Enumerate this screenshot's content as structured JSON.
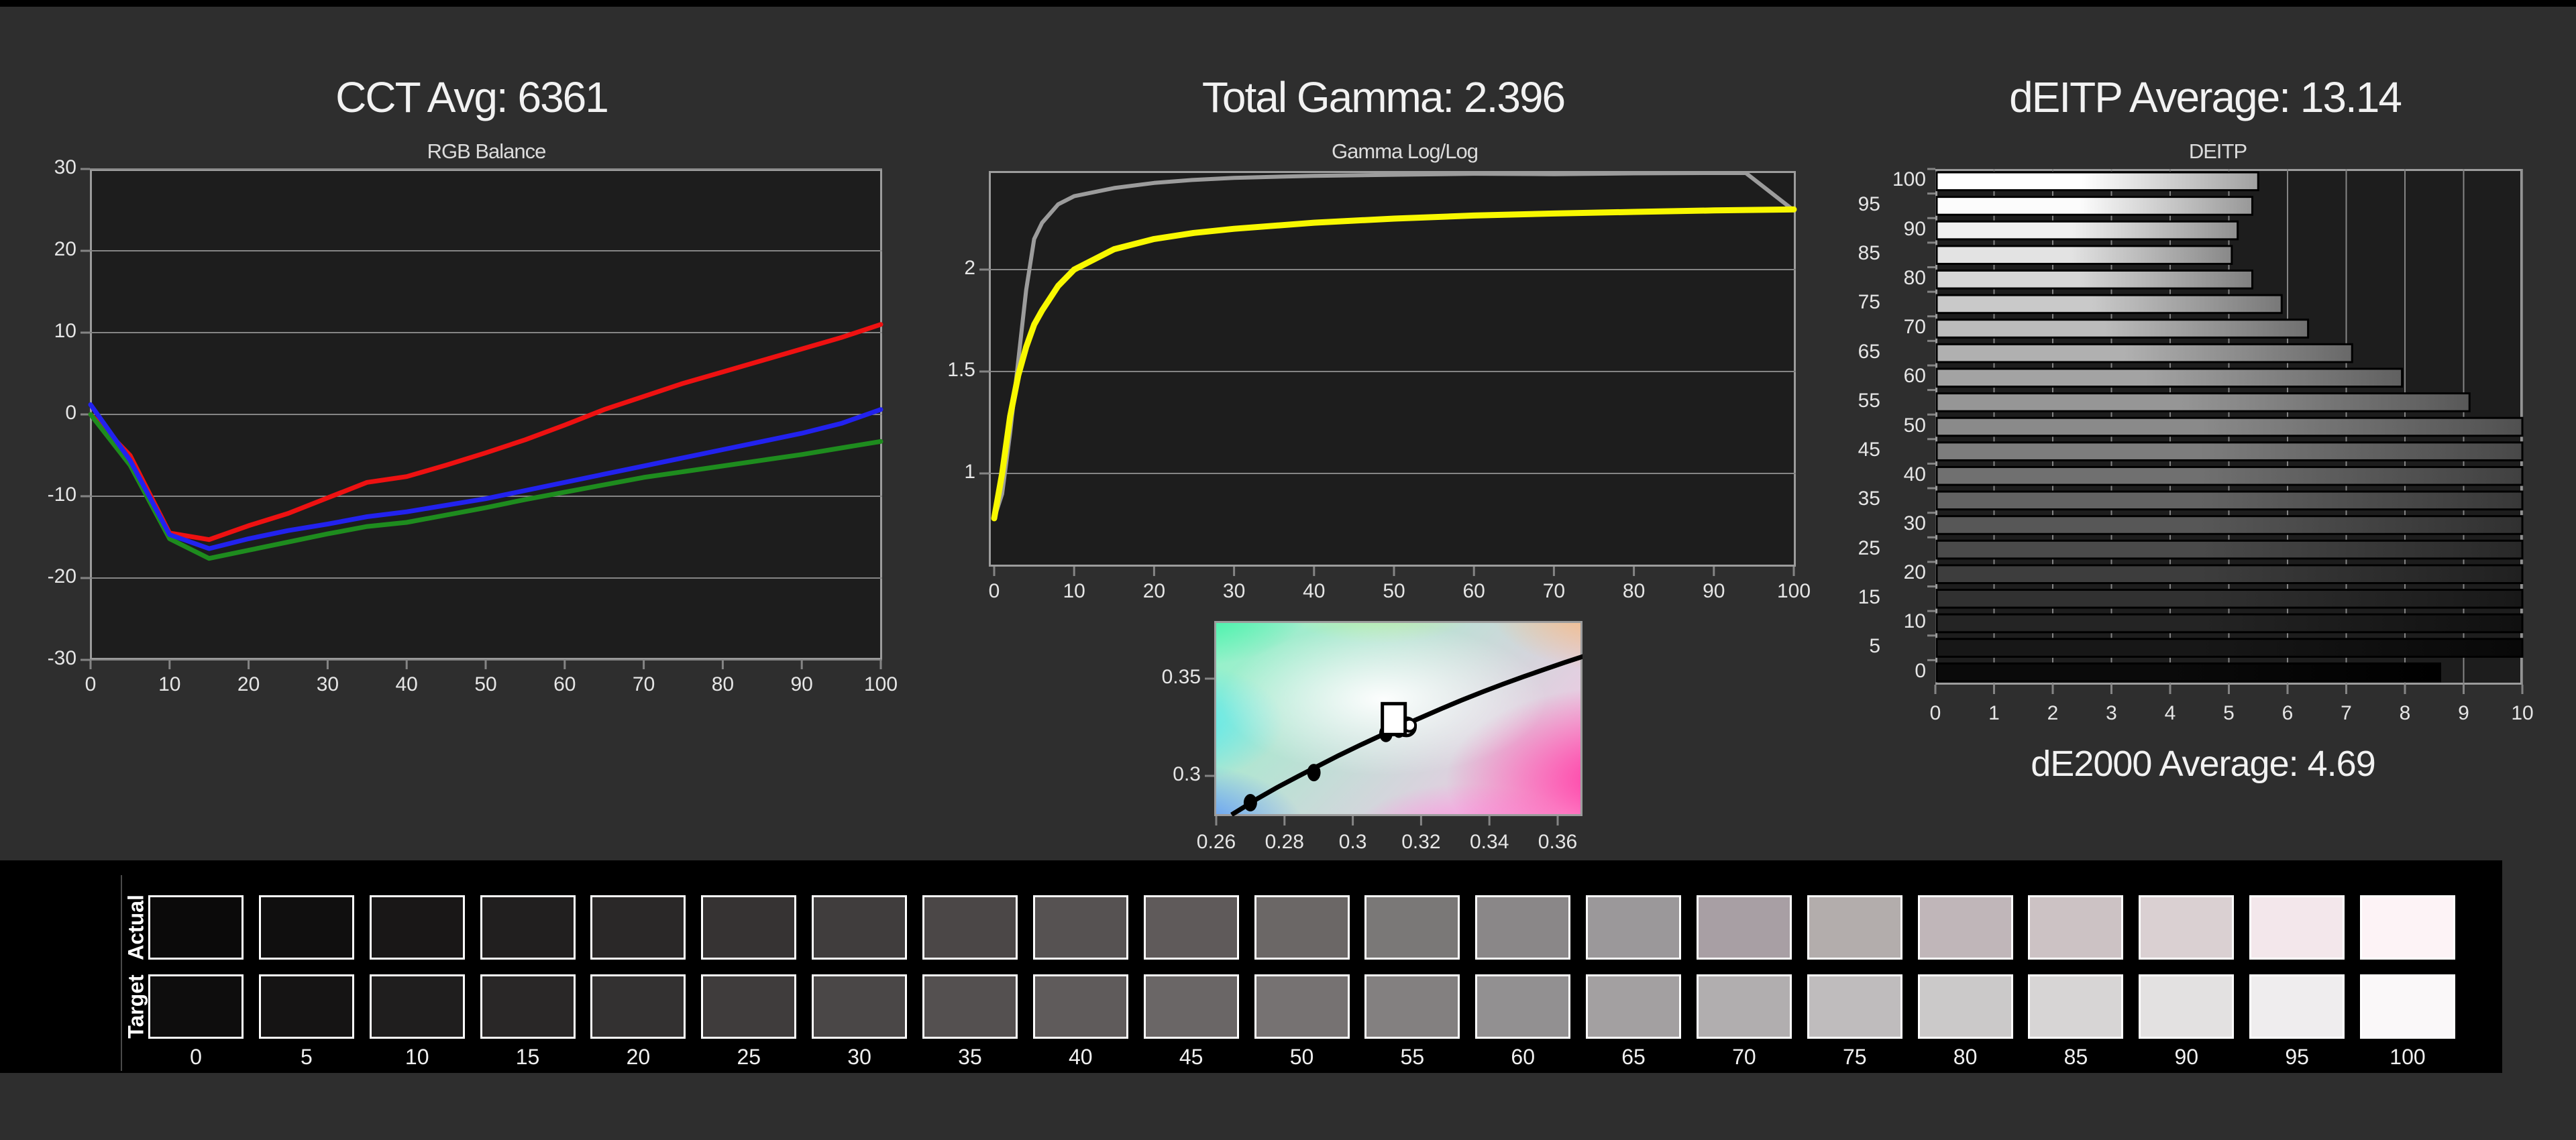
{
  "panels": {
    "cct": {
      "title": "CCT Avg: 6361",
      "chart_title": "RGB Balance"
    },
    "gamma": {
      "title": "Total Gamma: 2.396",
      "chart_title": "Gamma Log/Log"
    },
    "deitp": {
      "title": "dEITP Average: 13.14",
      "chart_title": "DEITP",
      "footer": "dE2000 Average: 4.69"
    }
  },
  "strip": {
    "row_labels": {
      "actual": "Actual",
      "target": "Target"
    }
  },
  "colors": {
    "red_line": "#ee1111",
    "green_line": "#1e8c1e",
    "blue_line": "#2222ee",
    "yellow_line": "#f8f800",
    "gray_line": "#9c9c9c",
    "grid": "#858585",
    "plot_border": "#9c9c9c",
    "plot_bg": "#1d1d1d",
    "page_bg": "#2e2e2e"
  },
  "chart_data": [
    {
      "id": "rgb_balance",
      "type": "line",
      "title": "RGB Balance",
      "xlabel": "",
      "ylabel": "",
      "ylim": [
        -30,
        30
      ],
      "xlim": [
        0,
        100
      ],
      "yticks": [
        30,
        20,
        10,
        0,
        -10,
        -20,
        -30
      ],
      "xticks": [
        0,
        10,
        20,
        30,
        40,
        50,
        60,
        70,
        80,
        90,
        100
      ],
      "x": [
        0,
        5,
        10,
        15,
        20,
        25,
        30,
        35,
        40,
        45,
        50,
        55,
        60,
        65,
        70,
        75,
        80,
        85,
        90,
        95,
        100
      ],
      "series": [
        {
          "name": "red",
          "values": [
            0,
            -5,
            -14.5,
            -15.3,
            -13.6,
            -12.1,
            -10.2,
            -8.3,
            -7.6,
            -6.2,
            -4.7,
            -3.1,
            -1.3,
            0.6,
            2.2,
            3.8,
            5.2,
            6.6,
            8.0,
            9.4,
            11.0
          ]
        },
        {
          "name": "green",
          "values": [
            0,
            -6.2,
            -15.2,
            -17.6,
            -16.6,
            -15.6,
            -14.6,
            -13.7,
            -13.2,
            -12.3,
            -11.4,
            -10.4,
            -9.5,
            -8.6,
            -7.7,
            -7.0,
            -6.3,
            -5.6,
            -4.9,
            -4.1,
            -3.3
          ]
        },
        {
          "name": "blue",
          "values": [
            1.2,
            -5.6,
            -14.7,
            -16.4,
            -15.2,
            -14.2,
            -13.4,
            -12.5,
            -11.9,
            -11.1,
            -10.3,
            -9.3,
            -8.3,
            -7.3,
            -6.3,
            -5.3,
            -4.3,
            -3.3,
            -2.3,
            -1.1,
            0.6
          ]
        }
      ]
    },
    {
      "id": "gamma_loglog",
      "type": "line",
      "title": "Gamma Log/Log",
      "ylim": [
        0.54,
        2.48
      ],
      "xlim": [
        0,
        100
      ],
      "yticks": [
        2,
        1.5,
        1
      ],
      "xticks": [
        0,
        10,
        20,
        30,
        40,
        50,
        60,
        70,
        80,
        90,
        100
      ],
      "series": [
        {
          "name": "measured",
          "x": [
            0,
            1,
            2,
            3,
            4,
            5,
            6,
            8,
            10,
            15,
            20,
            25,
            30,
            40,
            50,
            60,
            70,
            80,
            90,
            94,
            100
          ],
          "values": [
            0.78,
            0.9,
            1.2,
            1.55,
            1.9,
            2.15,
            2.23,
            2.32,
            2.36,
            2.4,
            2.425,
            2.44,
            2.45,
            2.46,
            2.465,
            2.47,
            2.468,
            2.472,
            2.48,
            2.485,
            2.29
          ]
        },
        {
          "name": "gamma",
          "x": [
            0,
            1,
            2,
            3,
            4,
            5,
            6,
            8,
            10,
            15,
            20,
            25,
            30,
            40,
            50,
            60,
            70,
            80,
            90,
            100
          ],
          "values": [
            0.78,
            1.0,
            1.28,
            1.48,
            1.62,
            1.73,
            1.8,
            1.92,
            2.0,
            2.1,
            2.15,
            2.18,
            2.2,
            2.23,
            2.25,
            2.265,
            2.275,
            2.283,
            2.29,
            2.295
          ]
        }
      ]
    },
    {
      "id": "cie_white_point",
      "type": "scatter",
      "xlim": [
        0.2594,
        0.3685
      ],
      "ylim": [
        0.28,
        0.38
      ],
      "xticks": [
        0.26,
        0.28,
        0.3,
        0.32,
        0.34,
        0.36
      ],
      "yticks": [
        0.35,
        0.3
      ],
      "locus": [
        [
          0.2645,
          0.28
        ],
        [
          0.268,
          0.2838
        ],
        [
          0.272,
          0.2882
        ],
        [
          0.278,
          0.2942
        ],
        [
          0.284,
          0.2998
        ],
        [
          0.29,
          0.3052
        ],
        [
          0.296,
          0.3106
        ],
        [
          0.302,
          0.3157
        ],
        [
          0.308,
          0.3206
        ],
        [
          0.314,
          0.3254
        ],
        [
          0.32,
          0.33
        ],
        [
          0.326,
          0.3346
        ],
        [
          0.332,
          0.339
        ],
        [
          0.338,
          0.3432
        ],
        [
          0.344,
          0.3472
        ],
        [
          0.35,
          0.351
        ],
        [
          0.356,
          0.3547
        ],
        [
          0.362,
          0.3583
        ],
        [
          0.3685,
          0.362
        ]
      ],
      "measured_points": [
        [
          0.27,
          0.2862
        ],
        [
          0.2886,
          0.3017
        ],
        [
          0.3097,
          0.3218
        ],
        [
          0.3135,
          0.324
        ],
        [
          0.315,
          0.3245
        ]
      ],
      "ring_point": [
        0.3157,
        0.3252
      ],
      "white_point": [
        0.3166,
        0.326
      ],
      "target_square": [
        0.312,
        0.3292
      ]
    },
    {
      "id": "deitp_bars",
      "type": "bar",
      "xlim": [
        0,
        10
      ],
      "xticks": [
        0,
        1,
        2,
        3,
        4,
        5,
        6,
        7,
        8,
        9,
        10
      ],
      "categories": [
        100,
        95,
        90,
        85,
        80,
        75,
        70,
        65,
        60,
        55,
        50,
        45,
        40,
        35,
        30,
        25,
        20,
        15,
        10,
        5,
        0
      ],
      "values": [
        5.5,
        5.4,
        5.15,
        5.05,
        5.4,
        5.9,
        6.35,
        7.1,
        7.95,
        9.1,
        10,
        10,
        10,
        10,
        10,
        10,
        10,
        10,
        10,
        10,
        8.6
      ],
      "bar_colors": [
        [
          "#ffffff",
          "#a0a0a0"
        ],
        [
          "#fcfcfc",
          "#989898"
        ],
        [
          "#efefef",
          "#909090"
        ],
        [
          "#e3e3e3",
          "#888888"
        ],
        [
          "#d6d6d6",
          "#808080"
        ],
        [
          "#c9c9c9",
          "#787878"
        ],
        [
          "#bcbcbc",
          "#707070"
        ],
        [
          "#b0b0b0",
          "#686868"
        ],
        [
          "#a3a3a3",
          "#606060"
        ],
        [
          "#969696",
          "#585858"
        ],
        [
          "#8a8a8a",
          "#505050"
        ],
        [
          "#7d7d7d",
          "#484848"
        ],
        [
          "#707070",
          "#404040"
        ],
        [
          "#636363",
          "#383838"
        ],
        [
          "#575757",
          "#303030"
        ],
        [
          "#4a4a4a",
          "#282828"
        ],
        [
          "#3d3d3d",
          "#202020"
        ],
        [
          "#313131",
          "#181818"
        ],
        [
          "#242424",
          "#101010"
        ],
        [
          "#171717",
          "#080808"
        ],
        [
          "#0a0a0a",
          "#000000"
        ]
      ]
    },
    {
      "id": "grayscale_strip",
      "type": "table",
      "levels": [
        0,
        5,
        10,
        15,
        20,
        25,
        30,
        35,
        40,
        45,
        50,
        55,
        60,
        65,
        70,
        75,
        80,
        85,
        90,
        95,
        100
      ],
      "actual": [
        "#0b0a0a",
        "#100f0f",
        "#191717",
        "#211f1f",
        "#2a2828",
        "#363333",
        "#403d3d",
        "#4b4747",
        "#565252",
        "#5f5a5a",
        "#6b6766",
        "#7a7877",
        "#8a8788",
        "#9b989a",
        "#a89fa4",
        "#b3adac",
        "#c0b6b9",
        "#ccc2c4",
        "#dad0d2",
        "#f3e7eb",
        "#fdf3f6"
      ],
      "target": [
        "#0e0d0d",
        "#151414",
        "#1f1e1e",
        "#292727",
        "#333131",
        "#3f3c3c",
        "#4a4747",
        "#545050",
        "#5f5b5b",
        "#6a6666",
        "#767272",
        "#838080",
        "#929091",
        "#a3a0a1",
        "#b1aeaf",
        "#bfbcbd",
        "#cbc9c9",
        "#d7d5d5",
        "#e3e1e1",
        "#efedee",
        "#faf8f9"
      ]
    }
  ]
}
